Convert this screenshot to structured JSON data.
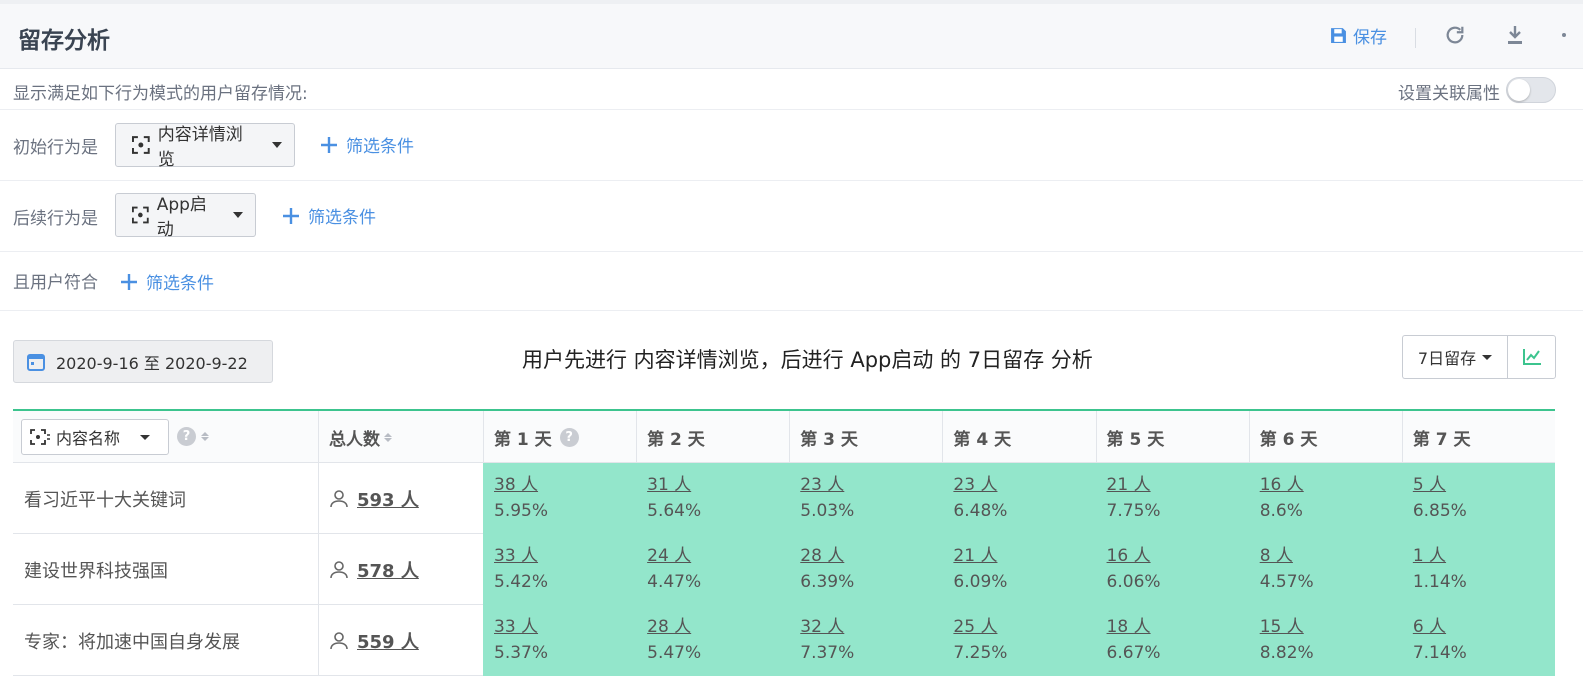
{
  "header": {
    "title": "留存分析",
    "save_label": "保存"
  },
  "config": {
    "description": "显示满足如下行为模式的用户留存情况:",
    "link_attr_label": "设置关联属性",
    "link_attr_enabled": false,
    "initial_label": "初始行为是",
    "initial_event": "内容详情浏览",
    "followup_label": "后续行为是",
    "followup_event": "App启动",
    "user_label": "且用户符合",
    "filter_label": "筛选条件"
  },
  "toolbar": {
    "date_range": "2020-9-16 至 2020-9-22",
    "summary": "用户先进行 内容详情浏览，后进行 App启动 的 7日留存 分析",
    "retention_select": "7日留存"
  },
  "table": {
    "dimension_select": "内容名称",
    "total_header": "总人数",
    "day_headers": [
      "第 1 天",
      "第 2 天",
      "第 3 天",
      "第 4 天",
      "第 5 天",
      "第 6 天",
      "第 7 天"
    ],
    "rows": [
      {
        "name": "看习近平十大关键词",
        "total": "593 人",
        "days": [
          {
            "count": "38 人",
            "rate": "5.95%"
          },
          {
            "count": "31 人",
            "rate": "5.64%"
          },
          {
            "count": "23 人",
            "rate": "5.03%"
          },
          {
            "count": "23 人",
            "rate": "6.48%"
          },
          {
            "count": "21 人",
            "rate": "7.75%"
          },
          {
            "count": "16 人",
            "rate": "8.6%"
          },
          {
            "count": "5 人",
            "rate": "6.85%"
          }
        ]
      },
      {
        "name": "建设世界科技强国",
        "total": "578 人",
        "days": [
          {
            "count": "33 人",
            "rate": "5.42%"
          },
          {
            "count": "24 人",
            "rate": "4.47%"
          },
          {
            "count": "28 人",
            "rate": "6.39%"
          },
          {
            "count": "21 人",
            "rate": "6.09%"
          },
          {
            "count": "16 人",
            "rate": "6.06%"
          },
          {
            "count": "8 人",
            "rate": "4.57%"
          },
          {
            "count": "1 人",
            "rate": "1.14%"
          }
        ]
      },
      {
        "name": "专家：将加速中国自身发展",
        "total": "559 人",
        "days": [
          {
            "count": "33 人",
            "rate": "5.37%"
          },
          {
            "count": "28 人",
            "rate": "5.47%"
          },
          {
            "count": "32 人",
            "rate": "7.37%"
          },
          {
            "count": "25 人",
            "rate": "7.25%"
          },
          {
            "count": "18 人",
            "rate": "6.67%"
          },
          {
            "count": "15 人",
            "rate": "8.82%"
          },
          {
            "count": "6 人",
            "rate": "7.14%"
          }
        ]
      }
    ]
  },
  "icons": {
    "save": "save-icon",
    "refresh": "refresh-icon",
    "download": "download-icon",
    "event": "event-icon",
    "plus": "plus-icon",
    "calendar": "calendar-icon",
    "chart": "line-chart-icon",
    "help": "help-icon",
    "user": "user-icon"
  },
  "colors": {
    "accent": "#4a90e2",
    "table_top_border": "#3cc48e",
    "retention_fill": "#93e6cb"
  }
}
